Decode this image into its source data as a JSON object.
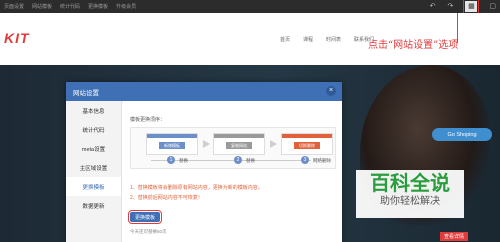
{
  "toolbar": {
    "menu": [
      "页面设置",
      "网站模板",
      "统计代码",
      "更换模板",
      "升级会员"
    ],
    "tools": {
      "undo": "↶",
      "redo": "↷",
      "settings_active": "▦",
      "more": "▢"
    }
  },
  "site": {
    "logo": "KIT",
    "nav": [
      "首页",
      "课程",
      "时间表",
      "联系我们"
    ],
    "cta": "Go Shoping",
    "detail": "查看详情"
  },
  "annotation": {
    "text": "点击“网站设置”选项"
  },
  "watermark": {
    "title": "百科全说",
    "subtitle": "助你轻松解决"
  },
  "modal": {
    "title": "网站设置",
    "close": "×",
    "sidebar": [
      "基本信息",
      "统计代码",
      "meta设置",
      "主区域设置",
      "更换模板",
      "数据更新"
    ],
    "active_index": 4,
    "steps_title": "模板更换须序：",
    "step_cards": [
      "新增模板",
      "复制网站",
      "切换删除"
    ],
    "step_labels": [
      "替换",
      "替换",
      "网络删除"
    ],
    "note1": "1、替换模板将会删除原有网站内容，更换为新的模板内容。",
    "note2": "2、替换前后网站内容不可恢复！",
    "replace_button": "更换模板",
    "count_text": "今天还可替换50次"
  },
  "colors": {
    "accent": "#3f6fb5",
    "brand": "#e23b3b",
    "watermark_green": "#2a9d3f"
  }
}
